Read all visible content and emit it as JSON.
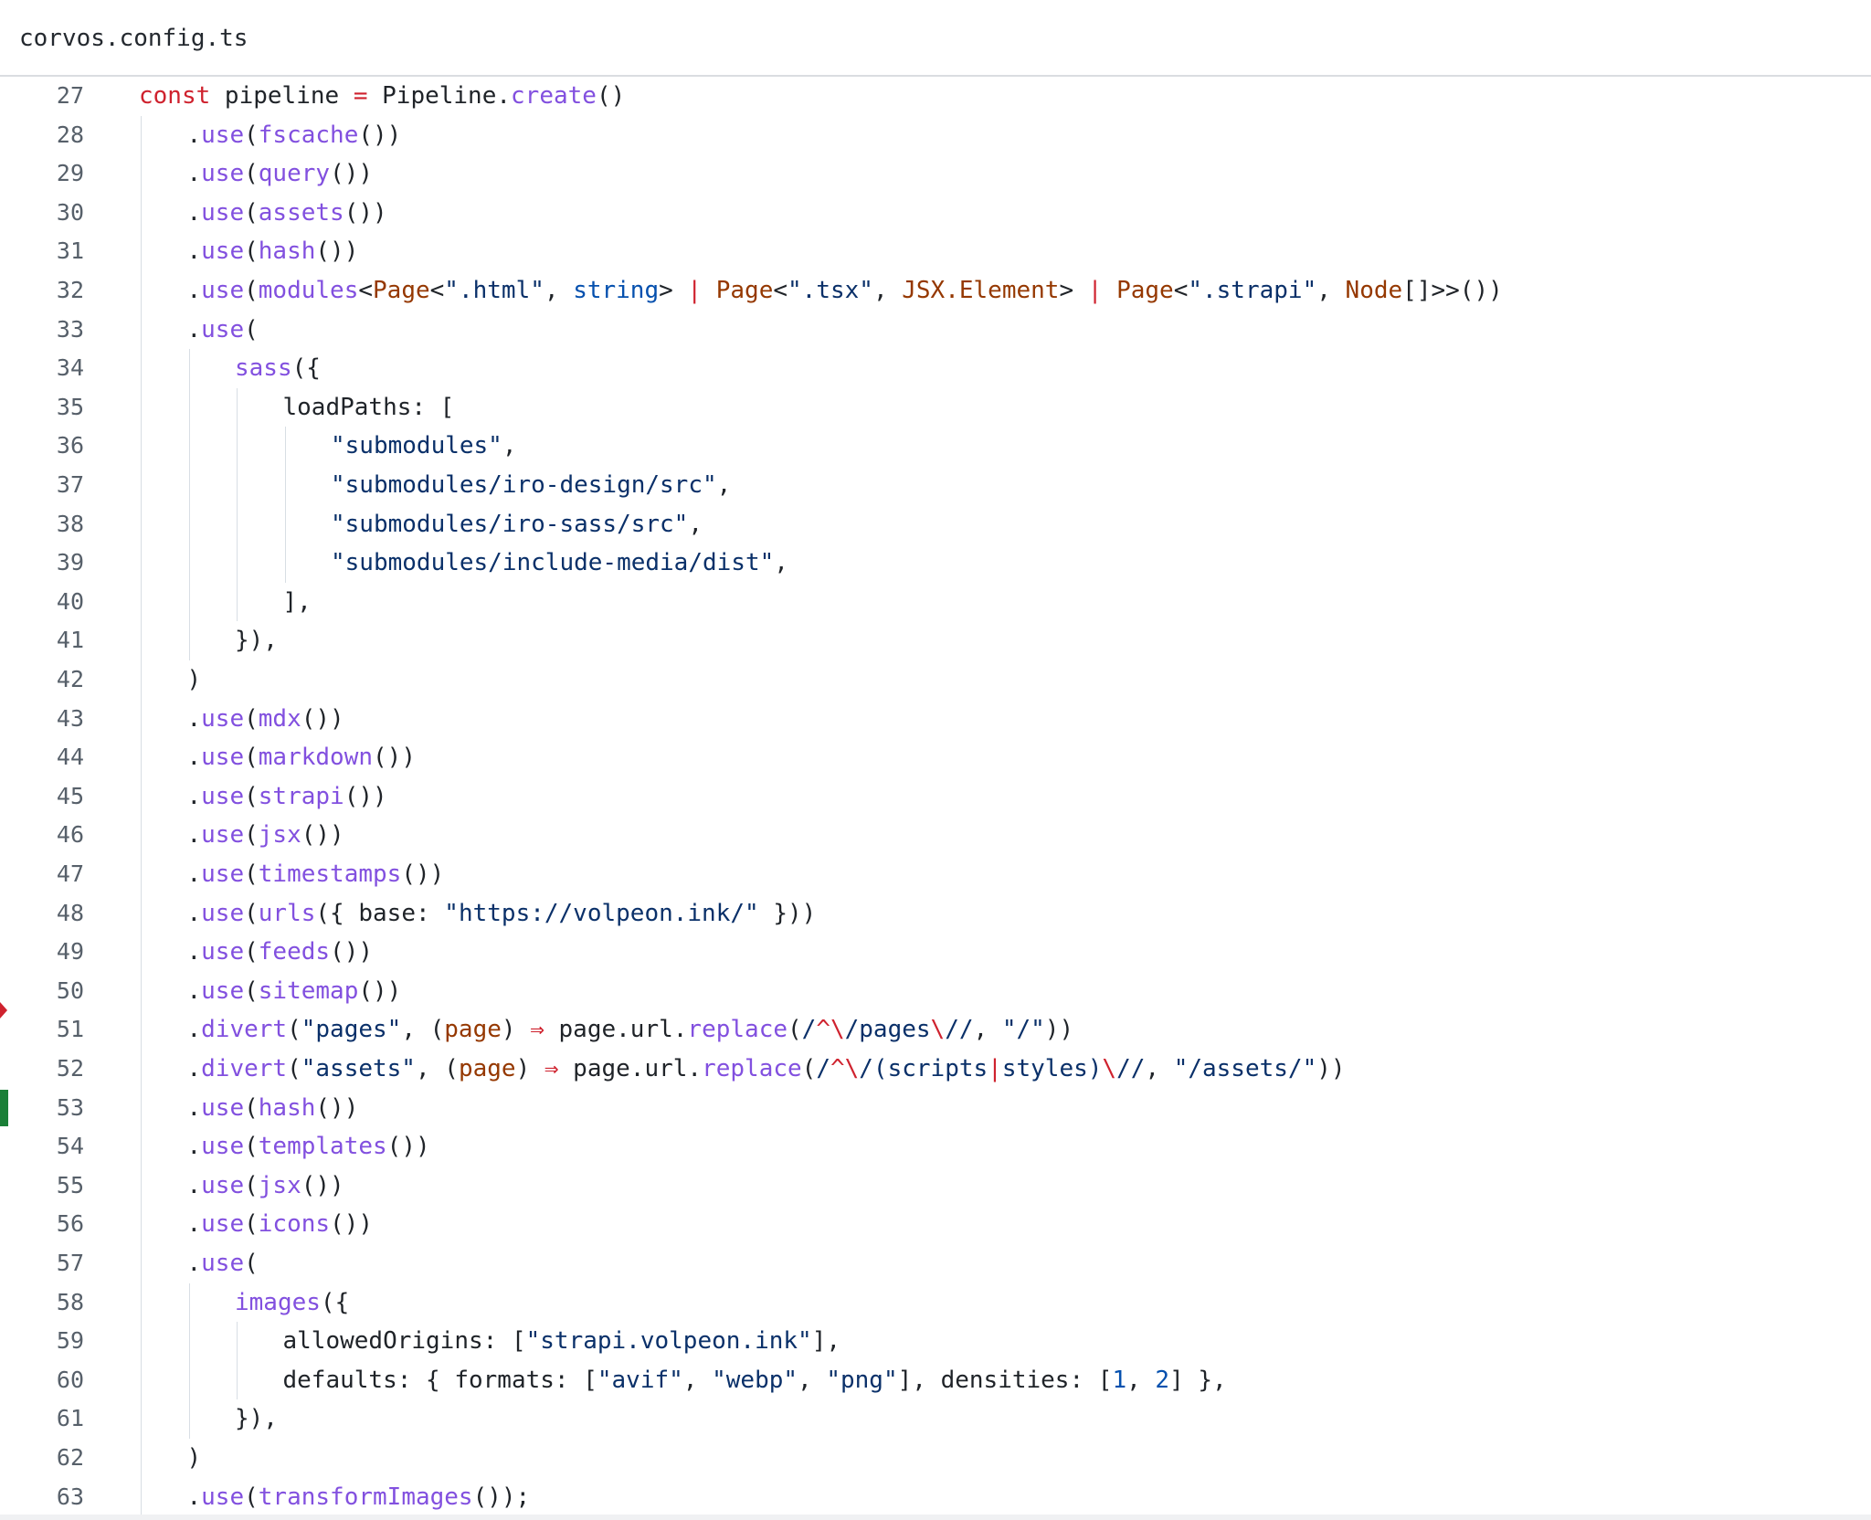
{
  "file": {
    "name": "corvos.config.ts"
  },
  "gutter": {
    "change_marker_color": "#1a7f37",
    "deletion_marker_color": "#cf222e"
  },
  "lines": [
    {
      "n": "27",
      "indent": 0,
      "tokens": [
        [
          "kw",
          "const"
        ],
        [
          "",
          " pipeline "
        ],
        [
          "op",
          "="
        ],
        [
          "",
          " Pipeline."
        ],
        [
          "fn",
          "create"
        ],
        [
          "",
          "()"
        ]
      ]
    },
    {
      "n": "28",
      "indent": 1,
      "tokens": [
        [
          "",
          "."
        ],
        [
          "fn",
          "use"
        ],
        [
          "",
          "("
        ],
        [
          "fn",
          "fscache"
        ],
        [
          "",
          "())"
        ]
      ]
    },
    {
      "n": "29",
      "indent": 1,
      "tokens": [
        [
          "",
          "."
        ],
        [
          "fn",
          "use"
        ],
        [
          "",
          "("
        ],
        [
          "fn",
          "query"
        ],
        [
          "",
          "())"
        ]
      ]
    },
    {
      "n": "30",
      "indent": 1,
      "tokens": [
        [
          "",
          "."
        ],
        [
          "fn",
          "use"
        ],
        [
          "",
          "("
        ],
        [
          "fn",
          "assets"
        ],
        [
          "",
          "())"
        ]
      ]
    },
    {
      "n": "31",
      "indent": 1,
      "tokens": [
        [
          "",
          "."
        ],
        [
          "fn",
          "use"
        ],
        [
          "",
          "("
        ],
        [
          "fn",
          "hash"
        ],
        [
          "",
          "())"
        ]
      ]
    },
    {
      "n": "32",
      "indent": 1,
      "tokens": [
        [
          "",
          "."
        ],
        [
          "fn",
          "use"
        ],
        [
          "",
          "("
        ],
        [
          "fn",
          "modules"
        ],
        [
          "",
          "<"
        ],
        [
          "ty",
          "Page"
        ],
        [
          "",
          "<"
        ],
        [
          "str",
          "\".html\""
        ],
        [
          "",
          ", "
        ],
        [
          "num",
          "string"
        ],
        [
          "",
          "> "
        ],
        [
          "op",
          "|"
        ],
        [
          "",
          " "
        ],
        [
          "ty",
          "Page"
        ],
        [
          "",
          "<"
        ],
        [
          "str",
          "\".tsx\""
        ],
        [
          "",
          ", "
        ],
        [
          "ty",
          "JSX.Element"
        ],
        [
          "",
          "> "
        ],
        [
          "op",
          "|"
        ],
        [
          "",
          " "
        ],
        [
          "ty",
          "Page"
        ],
        [
          "",
          "<"
        ],
        [
          "str",
          "\".strapi\""
        ],
        [
          "",
          ", "
        ],
        [
          "ty",
          "Node"
        ],
        [
          "",
          "[]>>())"
        ]
      ]
    },
    {
      "n": "33",
      "indent": 1,
      "tokens": [
        [
          "",
          "."
        ],
        [
          "fn",
          "use"
        ],
        [
          "",
          "("
        ]
      ]
    },
    {
      "n": "34",
      "indent": 2,
      "tokens": [
        [
          "fn",
          "sass"
        ],
        [
          "",
          "({"
        ]
      ]
    },
    {
      "n": "35",
      "indent": 3,
      "tokens": [
        [
          "",
          "loadPaths: ["
        ]
      ]
    },
    {
      "n": "36",
      "indent": 4,
      "tokens": [
        [
          "str",
          "\"submodules\""
        ],
        [
          "",
          ","
        ]
      ]
    },
    {
      "n": "37",
      "indent": 4,
      "tokens": [
        [
          "str",
          "\"submodules/iro-design/src\""
        ],
        [
          "",
          ","
        ]
      ]
    },
    {
      "n": "38",
      "indent": 4,
      "tokens": [
        [
          "str",
          "\"submodules/iro-sass/src\""
        ],
        [
          "",
          ","
        ]
      ]
    },
    {
      "n": "39",
      "indent": 4,
      "tokens": [
        [
          "str",
          "\"submodules/include-media/dist\""
        ],
        [
          "",
          ","
        ]
      ]
    },
    {
      "n": "40",
      "indent": 3,
      "tokens": [
        [
          "",
          "],"
        ]
      ]
    },
    {
      "n": "41",
      "indent": 2,
      "tokens": [
        [
          "",
          "}),"
        ]
      ]
    },
    {
      "n": "42",
      "indent": 1,
      "tokens": [
        [
          "",
          ")"
        ]
      ]
    },
    {
      "n": "43",
      "indent": 1,
      "tokens": [
        [
          "",
          "."
        ],
        [
          "fn",
          "use"
        ],
        [
          "",
          "("
        ],
        [
          "fn",
          "mdx"
        ],
        [
          "",
          "())"
        ]
      ]
    },
    {
      "n": "44",
      "indent": 1,
      "tokens": [
        [
          "",
          "."
        ],
        [
          "fn",
          "use"
        ],
        [
          "",
          "("
        ],
        [
          "fn",
          "markdown"
        ],
        [
          "",
          "())"
        ]
      ]
    },
    {
      "n": "45",
      "indent": 1,
      "tokens": [
        [
          "",
          "."
        ],
        [
          "fn",
          "use"
        ],
        [
          "",
          "("
        ],
        [
          "fn",
          "strapi"
        ],
        [
          "",
          "())"
        ]
      ]
    },
    {
      "n": "46",
      "indent": 1,
      "tokens": [
        [
          "",
          "."
        ],
        [
          "fn",
          "use"
        ],
        [
          "",
          "("
        ],
        [
          "fn",
          "jsx"
        ],
        [
          "",
          "())"
        ]
      ]
    },
    {
      "n": "47",
      "indent": 1,
      "tokens": [
        [
          "",
          "."
        ],
        [
          "fn",
          "use"
        ],
        [
          "",
          "("
        ],
        [
          "fn",
          "timestamps"
        ],
        [
          "",
          "())"
        ]
      ]
    },
    {
      "n": "48",
      "indent": 1,
      "tokens": [
        [
          "",
          "."
        ],
        [
          "fn",
          "use"
        ],
        [
          "",
          "("
        ],
        [
          "fn",
          "urls"
        ],
        [
          "",
          "({ base: "
        ],
        [
          "str",
          "\"https://volpeon.ink/\""
        ],
        [
          "",
          " }))"
        ]
      ]
    },
    {
      "n": "49",
      "indent": 1,
      "tokens": [
        [
          "",
          "."
        ],
        [
          "fn",
          "use"
        ],
        [
          "",
          "("
        ],
        [
          "fn",
          "feeds"
        ],
        [
          "",
          "())"
        ]
      ]
    },
    {
      "n": "50",
      "indent": 1,
      "tokens": [
        [
          "",
          "."
        ],
        [
          "fn",
          "use"
        ],
        [
          "",
          "("
        ],
        [
          "fn",
          "sitemap"
        ],
        [
          "",
          "())"
        ]
      ]
    },
    {
      "n": "51",
      "indent": 1,
      "tokens": [
        [
          "",
          "."
        ],
        [
          "fn",
          "divert"
        ],
        [
          "",
          "("
        ],
        [
          "str",
          "\"pages\""
        ],
        [
          "",
          ", ("
        ],
        [
          "param",
          "page"
        ],
        [
          "",
          ") "
        ],
        [
          "op",
          "⇒"
        ],
        [
          "",
          " page.url."
        ],
        [
          "fn",
          "replace"
        ],
        [
          "",
          "("
        ],
        [
          "str",
          "/"
        ],
        [
          "op",
          "^\\"
        ],
        [
          "str",
          "/pages"
        ],
        [
          "op",
          "\\"
        ],
        [
          "str",
          "//"
        ],
        [
          "",
          ", "
        ],
        [
          "str",
          "\"/\""
        ],
        [
          "",
          "))"
        ]
      ]
    },
    {
      "n": "52",
      "indent": 1,
      "tokens": [
        [
          "",
          "."
        ],
        [
          "fn",
          "divert"
        ],
        [
          "",
          "("
        ],
        [
          "str",
          "\"assets\""
        ],
        [
          "",
          ", ("
        ],
        [
          "param",
          "page"
        ],
        [
          "",
          ") "
        ],
        [
          "op",
          "⇒"
        ],
        [
          "",
          " page.url."
        ],
        [
          "fn",
          "replace"
        ],
        [
          "",
          "("
        ],
        [
          "str",
          "/"
        ],
        [
          "op",
          "^\\"
        ],
        [
          "str",
          "/(scripts"
        ],
        [
          "op",
          "|"
        ],
        [
          "str",
          "styles)"
        ],
        [
          "op",
          "\\"
        ],
        [
          "str",
          "//"
        ],
        [
          "",
          ", "
        ],
        [
          "str",
          "\"/assets/\""
        ],
        [
          "",
          "))"
        ]
      ]
    },
    {
      "n": "53",
      "indent": 1,
      "tokens": [
        [
          "",
          "."
        ],
        [
          "fn",
          "use"
        ],
        [
          "",
          "("
        ],
        [
          "fn",
          "hash"
        ],
        [
          "",
          "())"
        ]
      ]
    },
    {
      "n": "54",
      "indent": 1,
      "tokens": [
        [
          "",
          "."
        ],
        [
          "fn",
          "use"
        ],
        [
          "",
          "("
        ],
        [
          "fn",
          "templates"
        ],
        [
          "",
          "())"
        ]
      ]
    },
    {
      "n": "55",
      "indent": 1,
      "tokens": [
        [
          "",
          "."
        ],
        [
          "fn",
          "use"
        ],
        [
          "",
          "("
        ],
        [
          "fn",
          "jsx"
        ],
        [
          "",
          "())"
        ]
      ]
    },
    {
      "n": "56",
      "indent": 1,
      "tokens": [
        [
          "",
          "."
        ],
        [
          "fn",
          "use"
        ],
        [
          "",
          "("
        ],
        [
          "fn",
          "icons"
        ],
        [
          "",
          "())"
        ]
      ]
    },
    {
      "n": "57",
      "indent": 1,
      "tokens": [
        [
          "",
          "."
        ],
        [
          "fn",
          "use"
        ],
        [
          "",
          "("
        ]
      ]
    },
    {
      "n": "58",
      "indent": 2,
      "tokens": [
        [
          "fn",
          "images"
        ],
        [
          "",
          "({"
        ]
      ]
    },
    {
      "n": "59",
      "indent": 3,
      "tokens": [
        [
          "",
          "allowedOrigins: ["
        ],
        [
          "str",
          "\"strapi.volpeon.ink\""
        ],
        [
          "",
          "],"
        ]
      ]
    },
    {
      "n": "60",
      "indent": 3,
      "tokens": [
        [
          "",
          "defaults: { formats: ["
        ],
        [
          "str",
          "\"avif\""
        ],
        [
          "",
          ", "
        ],
        [
          "str",
          "\"webp\""
        ],
        [
          "",
          ", "
        ],
        [
          "str",
          "\"png\""
        ],
        [
          "",
          "], densities: ["
        ],
        [
          "num",
          "1"
        ],
        [
          "",
          ", "
        ],
        [
          "num",
          "2"
        ],
        [
          "",
          "] },"
        ]
      ]
    },
    {
      "n": "61",
      "indent": 2,
      "tokens": [
        [
          "",
          "}),"
        ]
      ]
    },
    {
      "n": "62",
      "indent": 1,
      "tokens": [
        [
          "",
          ")"
        ]
      ]
    },
    {
      "n": "63",
      "indent": 1,
      "tokens": [
        [
          "",
          "."
        ],
        [
          "fn",
          "use"
        ],
        [
          "",
          "("
        ],
        [
          "fn",
          "transformImages"
        ],
        [
          "",
          "());"
        ]
      ]
    }
  ]
}
